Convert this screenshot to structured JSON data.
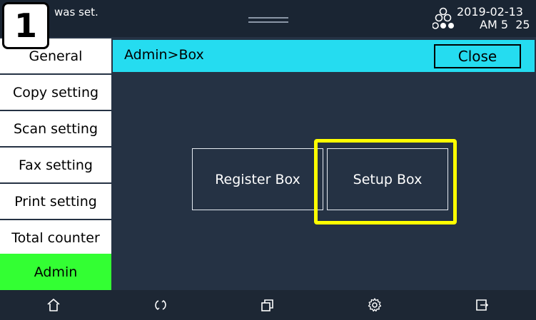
{
  "status_bar": {
    "message": "was set.",
    "date": "2019-02-13",
    "time": "AM 5  25",
    "network_icon": "network-nodes-icon"
  },
  "step_badge": "1",
  "sidebar": {
    "items": [
      {
        "label": "General"
      },
      {
        "label": "Copy setting"
      },
      {
        "label": "Scan setting"
      },
      {
        "label": "Fax setting"
      },
      {
        "label": "Print setting"
      },
      {
        "label": "Total counter"
      },
      {
        "label": "Admin",
        "active": true
      }
    ]
  },
  "header": {
    "breadcrumb": "Admin>Box",
    "close_label": "Close"
  },
  "main": {
    "register_box_label": "Register Box",
    "setup_box_label": "Setup Box"
  },
  "bottom_nav": {
    "icons": [
      "home-icon",
      "refresh-icon",
      "windows-icon",
      "settings-gear-icon",
      "logout-icon"
    ]
  },
  "colors": {
    "header_bg": "#25dcf0",
    "active_item_bg": "#33ff33",
    "highlight": "#ffff00",
    "background": "#253244"
  }
}
